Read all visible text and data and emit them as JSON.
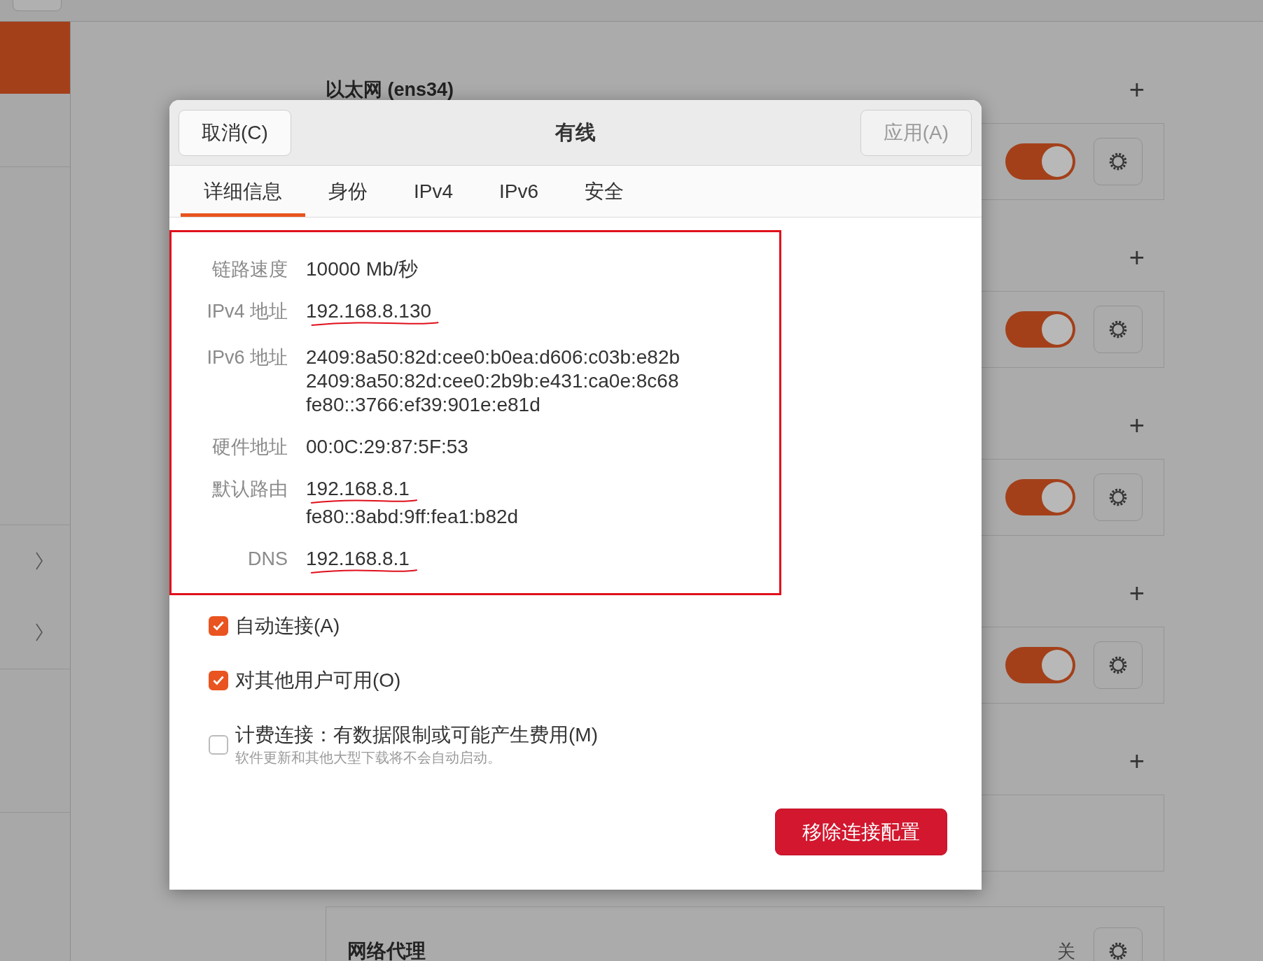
{
  "sidebar": {
    "items": [
      {
        "selected": true,
        "chevron": false
      },
      {
        "selected": false,
        "chevron": true
      },
      {
        "selected": false,
        "chevron": true
      }
    ]
  },
  "sections": [
    {
      "title": "以太网 (ens34)",
      "add_icon": "+",
      "card": {
        "kind": "toggle",
        "on": true
      }
    },
    {
      "add_icon": "+",
      "card": {
        "kind": "toggle",
        "on": true
      }
    },
    {
      "add_icon": "+",
      "card": {
        "kind": "toggle",
        "on": true
      }
    },
    {
      "add_icon": "+",
      "card": {
        "kind": "toggle",
        "on": true
      }
    },
    {
      "add_icon": "+",
      "card": {
        "kind": "empty"
      }
    },
    {
      "card": {
        "kind": "status",
        "label": "网络代理",
        "status": "关"
      }
    }
  ],
  "dialog": {
    "title": "有线",
    "cancel_button": "取消(C)",
    "apply_button": {
      "label": "应用(A)",
      "disabled": true
    },
    "tabs": [
      {
        "label": "详细信息",
        "selected": true
      },
      {
        "label": "身份",
        "selected": false
      },
      {
        "label": "IPv4",
        "selected": false
      },
      {
        "label": "IPv6",
        "selected": false
      },
      {
        "label": "安全",
        "selected": false
      }
    ],
    "details": {
      "highlighted": true,
      "rows": [
        {
          "label": "链路速度",
          "values": [
            {
              "text": "10000 Mb/秒",
              "underlined": false
            }
          ]
        },
        {
          "label": "IPv4 地址",
          "values": [
            {
              "text": "192.168.8.130",
              "underlined": true
            }
          ]
        },
        {
          "label": "IPv6 地址",
          "values": [
            {
              "text": "2409:8a50:82d:cee0:b0ea:d606:c03b:e82b",
              "underlined": false
            },
            {
              "text": "2409:8a50:82d:cee0:2b9b:e431:ca0e:8c68",
              "underlined": false
            },
            {
              "text": "fe80::3766:ef39:901e:e81d",
              "underlined": false
            }
          ]
        },
        {
          "label": "硬件地址",
          "values": [
            {
              "text": "00:0C:29:87:5F:53",
              "underlined": false
            }
          ]
        },
        {
          "label": "默认路由",
          "values": [
            {
              "text": "192.168.8.1",
              "underlined": true
            },
            {
              "text": "fe80::8abd:9ff:fea1:b82d",
              "underlined": false
            }
          ]
        },
        {
          "label": "DNS",
          "values": [
            {
              "text": "192.168.8.1",
              "underlined": true
            }
          ]
        }
      ]
    },
    "options": [
      {
        "label": "自动连接(A)",
        "checked": true
      },
      {
        "label": "对其他用户可用(O)",
        "checked": true
      },
      {
        "label": "计费连接：有数据限制或可能产生费用(M)",
        "hint": "软件更新和其他大型下载将不会自动启动。",
        "checked": false
      }
    ],
    "remove_button": "移除连接配置"
  }
}
